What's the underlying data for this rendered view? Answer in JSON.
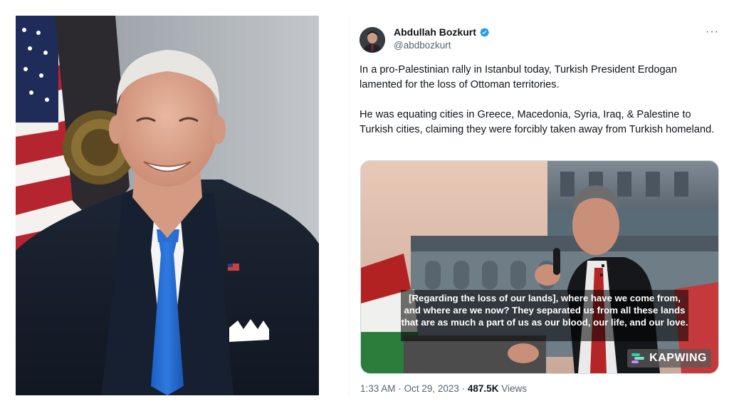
{
  "portrait": {
    "alt": "Official portrait photo"
  },
  "tweet": {
    "display_name": "Abdullah Bozkurt",
    "handle": "@abdbozkurt",
    "more_label": "···",
    "paragraphs": [
      "In a pro-Palestinian rally in Istanbul today, Turkish President Erdogan lamented for the loss of Ottoman territories.",
      "He was equating cities in Greece, Macedonia, Syria, Iraq, & Palestine to Turkish cities, claiming they were forcibly taken away from Turkish homeland."
    ],
    "video": {
      "caption": "[Regarding the loss of our lands], where have we come from, and where are we now? They separated us from all these lands that are as much a part of us as our blood, our life, and our love.",
      "watermark": "KAPWING"
    },
    "time": "1:33 AM",
    "separator": "·",
    "date": "Oct 29, 2023",
    "views_count": "487.5K",
    "views_label": "Views"
  },
  "colors": {
    "verified": "#1d9bf0",
    "text_primary": "#0f1419",
    "text_secondary": "#536471"
  }
}
